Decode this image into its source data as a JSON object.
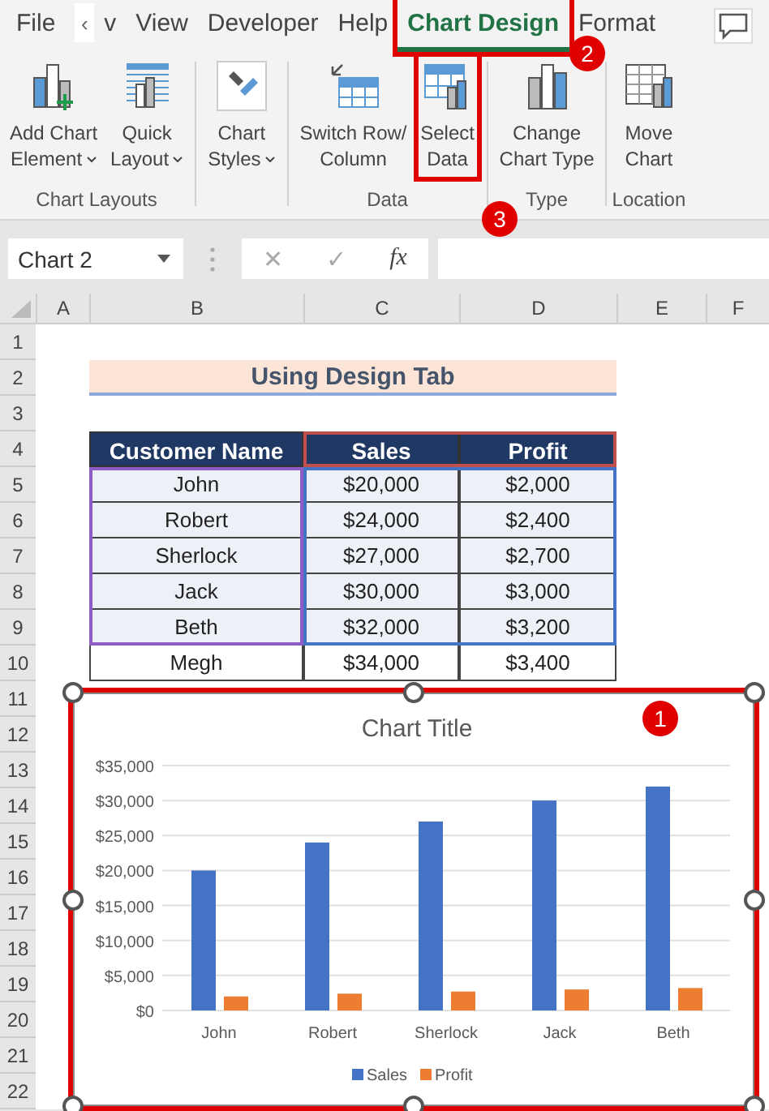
{
  "ribbon_tabs": [
    {
      "label": "File",
      "selected": false
    },
    {
      "label": "‹",
      "kind": "scroll"
    },
    {
      "label": "v",
      "selected": false
    },
    {
      "label": "View",
      "selected": false
    },
    {
      "label": "Developer",
      "selected": false
    },
    {
      "label": "Help",
      "selected": false
    },
    {
      "label": "Chart Design",
      "selected": true,
      "annotated": true
    },
    {
      "label": "Format",
      "selected": false
    }
  ],
  "ribbon_groups": [
    {
      "label": "Chart Layouts",
      "buttons": [
        {
          "label": "Add Chart\nElement",
          "kind": "add-chart",
          "dropdown": true
        },
        {
          "label": "Quick\nLayout",
          "kind": "quick-layout",
          "dropdown": true
        }
      ]
    },
    {
      "buttons": [
        {
          "label": "Chart\nStyles",
          "kind": "styles",
          "dropdown": true
        }
      ]
    },
    {
      "label": "Data",
      "buttons": [
        {
          "label": "Switch Row/\nColumn",
          "kind": "switch",
          "dropdown": false
        },
        {
          "label": "Select\nData",
          "kind": "select-data",
          "dropdown": false,
          "annotated": true
        }
      ]
    },
    {
      "label": "Type",
      "buttons": [
        {
          "label": "Change\nChart Type",
          "kind": "change-type",
          "dropdown": false
        }
      ]
    },
    {
      "label": "Location",
      "buttons": [
        {
          "label": "Move\nChart",
          "kind": "move-chart",
          "dropdown": false
        }
      ]
    }
  ],
  "formula_bar": {
    "name_box": "Chart 2",
    "cancel": "✕",
    "enter": "✓",
    "function": "fx"
  },
  "column_headers": [
    "A",
    "B",
    "C",
    "D",
    "E",
    "F"
  ],
  "row_headers": [
    "1",
    "2",
    "3",
    "4",
    "5",
    "6",
    "7",
    "8",
    "9",
    "10",
    "11",
    "12",
    "13",
    "14",
    "15",
    "16",
    "17",
    "18",
    "19",
    "20",
    "21",
    "22"
  ],
  "sheet_title": "Using Design Tab",
  "table": {
    "columns": [
      "Customer Name",
      "Sales",
      "Profit"
    ],
    "rows": [
      [
        "John",
        "$20,000",
        "$2,000"
      ],
      [
        "Robert",
        "$24,000",
        "$2,400"
      ],
      [
        "Sherlock",
        "$27,000",
        "$2,700"
      ],
      [
        "Jack",
        "$30,000",
        "$3,000"
      ],
      [
        "Beth",
        "$32,000",
        "$3,200"
      ],
      [
        "Megh",
        "$34,000",
        "$3,400"
      ]
    ]
  },
  "range_outlines": [
    {
      "kind": "categories",
      "color": "#8e5cc4"
    },
    {
      "kind": "series_names",
      "color": "#c0504d"
    },
    {
      "kind": "values",
      "color": "#4472c4"
    }
  ],
  "chart": {
    "selected": true,
    "chart_data": {
      "type": "bar",
      "title": "Chart Title",
      "categories": [
        "John",
        "Robert",
        "Sherlock",
        "Jack",
        "Beth"
      ],
      "series": [
        {
          "name": "Sales",
          "color": "#4472c4",
          "values": [
            20000,
            24000,
            27000,
            30000,
            32000
          ]
        },
        {
          "name": "Profit",
          "color": "#ed7d31",
          "values": [
            2000,
            2400,
            2700,
            3000,
            3200
          ]
        }
      ],
      "ylim": [
        0,
        35000
      ],
      "grid": true,
      "legend": true,
      "yticks": [
        {
          "value": 0,
          "label": "$0"
        },
        {
          "value": 5000,
          "label": "$5,000"
        },
        {
          "value": 10000,
          "label": "$10,000"
        },
        {
          "value": 15000,
          "label": "$15,000"
        },
        {
          "value": 20000,
          "label": "$20,000"
        },
        {
          "value": 25000,
          "label": "$25,000"
        },
        {
          "value": 30000,
          "label": "$30,000"
        },
        {
          "value": 35000,
          "label": "$35,000"
        }
      ]
    }
  },
  "callouts": [
    "1",
    "2",
    "3"
  ]
}
